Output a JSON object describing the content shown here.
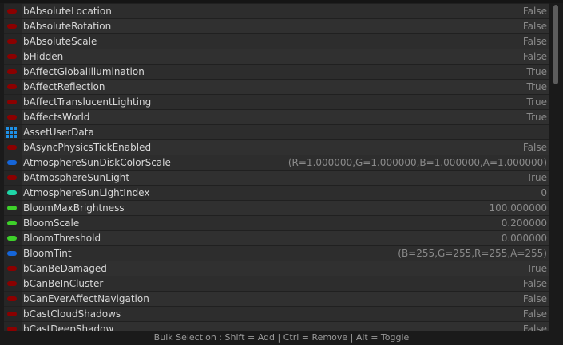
{
  "colors": {
    "bool": "#8b0000",
    "struct": "#1e90e6",
    "int": "#1fd6a7",
    "float": "#3ed12a",
    "color_struct": "#1565d8"
  },
  "rows": [
    {
      "name": "bAbsoluteLocation",
      "value": "False",
      "type": "bool"
    },
    {
      "name": "bAbsoluteRotation",
      "value": "False",
      "type": "bool"
    },
    {
      "name": "bAbsoluteScale",
      "value": "False",
      "type": "bool"
    },
    {
      "name": "bHidden",
      "value": "False",
      "type": "bool"
    },
    {
      "name": "bAffectGlobalIllumination",
      "value": "True",
      "type": "bool"
    },
    {
      "name": "bAffectReflection",
      "value": "True",
      "type": "bool"
    },
    {
      "name": "bAffectTranslucentLighting",
      "value": "True",
      "type": "bool"
    },
    {
      "name": "bAffectsWorld",
      "value": "True",
      "type": "bool"
    },
    {
      "name": "AssetUserData",
      "value": "",
      "type": "struct-grid"
    },
    {
      "name": "bAsyncPhysicsTickEnabled",
      "value": "False",
      "type": "bool"
    },
    {
      "name": "AtmosphereSunDiskColorScale",
      "value": "(R=1.000000,G=1.000000,B=1.000000,A=1.000000)",
      "type": "color_struct"
    },
    {
      "name": "bAtmosphereSunLight",
      "value": "True",
      "type": "bool"
    },
    {
      "name": "AtmosphereSunLightIndex",
      "value": "0",
      "type": "int"
    },
    {
      "name": "BloomMaxBrightness",
      "value": "100.000000",
      "type": "float"
    },
    {
      "name": "BloomScale",
      "value": "0.200000",
      "type": "float"
    },
    {
      "name": "BloomThreshold",
      "value": "0.000000",
      "type": "float"
    },
    {
      "name": "BloomTint",
      "value": "(B=255,G=255,R=255,A=255)",
      "type": "color_struct"
    },
    {
      "name": "bCanBeDamaged",
      "value": "True",
      "type": "bool"
    },
    {
      "name": "bCanBeInCluster",
      "value": "False",
      "type": "bool"
    },
    {
      "name": "bCanEverAffectNavigation",
      "value": "False",
      "type": "bool"
    },
    {
      "name": "bCastCloudShadows",
      "value": "False",
      "type": "bool"
    },
    {
      "name": "bCastDeepShadow",
      "value": "False",
      "type": "bool"
    }
  ],
  "status": {
    "text": "Bulk Selection : Shift = Add | Ctrl = Remove | Alt = Toggle"
  }
}
